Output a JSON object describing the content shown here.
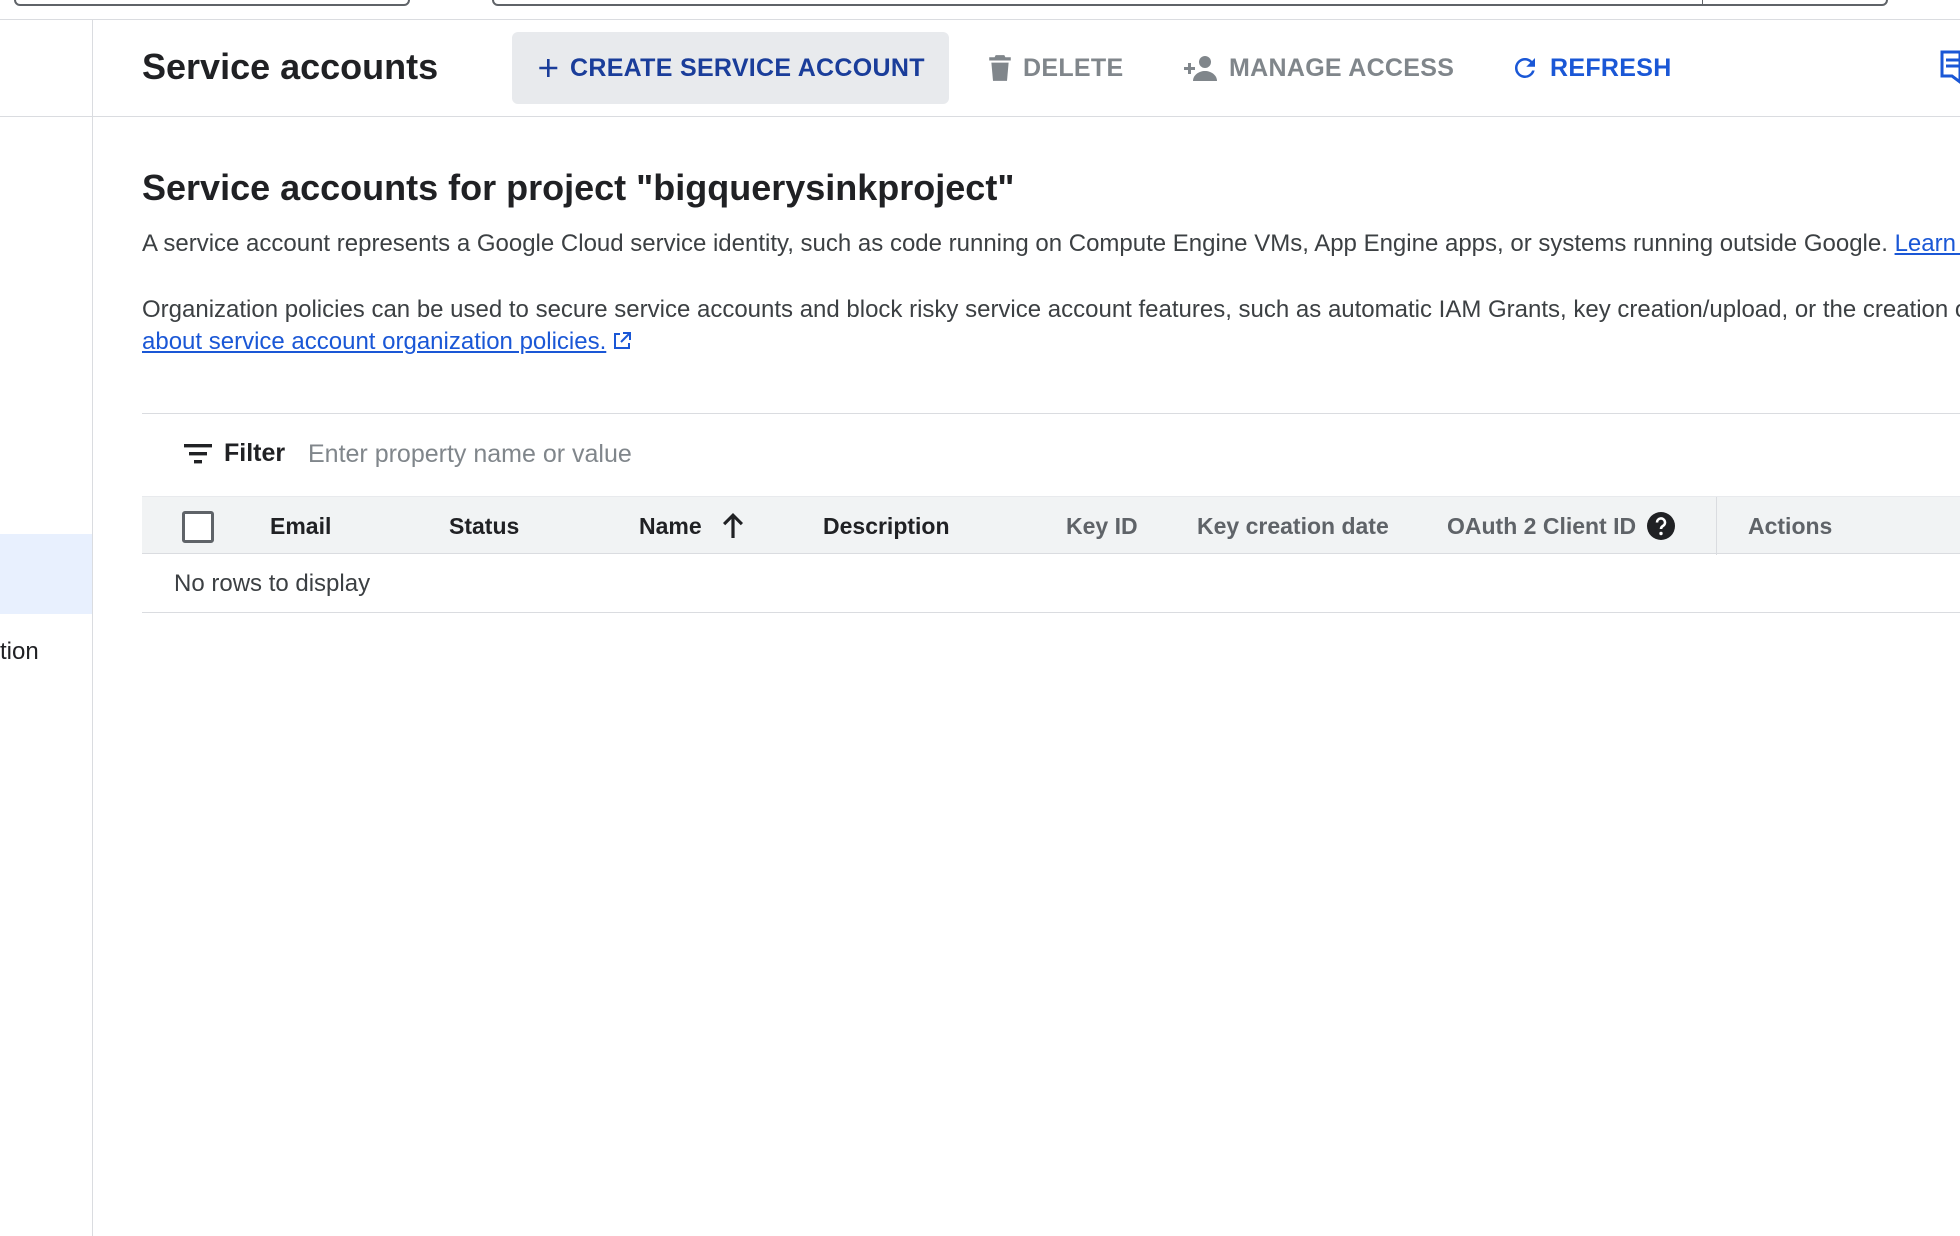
{
  "toolbar": {
    "title": "Service accounts",
    "create_label": "CREATE SERVICE ACCOUNT",
    "delete_label": "DELETE",
    "manage_access_label": "MANAGE ACCESS",
    "refresh_label": "REFRESH"
  },
  "leftnav": {
    "partial_item_label": "tion"
  },
  "main": {
    "section_title": "Service accounts for project \"bigquerysinkproject\"",
    "description": "A service account represents a Google Cloud service identity, such as code running on Compute Engine VMs, App Engine apps, or systems running outside Google.",
    "learn_more_link": "Learn m",
    "org_policy_text": "Organization policies can be used to secure service accounts and block risky service account features, such as automatic IAM Grants, key creation/upload, or the creation o",
    "org_policy_link": "about service account organization policies."
  },
  "filter": {
    "label": "Filter",
    "placeholder": "Enter property name or value"
  },
  "table": {
    "columns": {
      "email": "Email",
      "status": "Status",
      "name": "Name",
      "description": "Description",
      "key_id": "Key ID",
      "key_creation_date": "Key creation date",
      "oauth_client_id": "OAuth 2 Client ID",
      "actions": "Actions"
    },
    "sort": {
      "column": "Name",
      "direction": "ascending"
    },
    "empty_message": "No rows to display"
  },
  "icons": {
    "create": "plus-icon",
    "delete": "trash-icon",
    "manage_access": "person-add-icon",
    "refresh": "refresh-icon",
    "filter": "filter-icon",
    "sort": "arrow-up-icon",
    "help": "help-icon",
    "external_link": "external-link-icon"
  },
  "colors": {
    "primary_blue": "#1a57d6",
    "create_text": "#1a3d9a",
    "disabled_gray": "#80868b",
    "header_bg": "#f1f3f4"
  }
}
